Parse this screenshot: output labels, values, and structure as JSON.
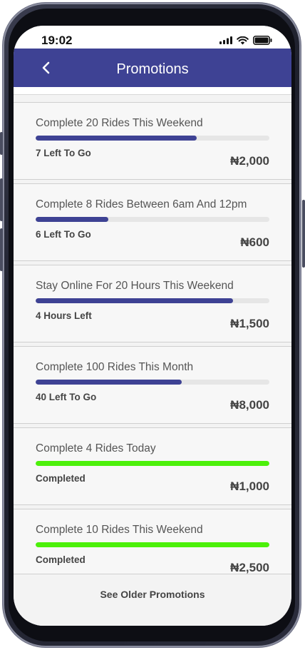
{
  "status_bar": {
    "time": "19:02",
    "icons": [
      "signal-icon",
      "wifi-icon",
      "battery-icon"
    ]
  },
  "header": {
    "back_icon": "chevron-left-icon",
    "title": "Promotions",
    "background": "#3e4294"
  },
  "colors": {
    "progress_active": "#3e4294",
    "progress_complete": "#4cf00a",
    "progress_track": "#e6e6e6"
  },
  "promotions": [
    {
      "title": "Complete 20 Rides This Weekend",
      "status": "7 Left To Go",
      "reward": "₦2,000",
      "progress": 0.69,
      "completed": false
    },
    {
      "title": "Complete 8 Rides Between 6am And 12pm",
      "status": "6 Left To Go",
      "reward": "₦600",
      "progress": 0.31,
      "completed": false
    },
    {
      "title": "Stay Online For 20 Hours This Weekend",
      "status": "4 Hours Left",
      "reward": "₦1,500",
      "progress": 0.845,
      "completed": false
    },
    {
      "title": "Complete 100 Rides This Month",
      "status": "40 Left To Go",
      "reward": "₦8,000",
      "progress": 0.625,
      "completed": false
    },
    {
      "title": "Complete 4 Rides Today",
      "status": "Completed",
      "reward": "₦1,000",
      "progress": 1.0,
      "completed": true
    },
    {
      "title": "Complete 10 Rides This Weekend",
      "status": "Completed",
      "reward": "₦2,500",
      "progress": 1.0,
      "completed": true
    }
  ],
  "footer": {
    "link_label": "See Older Promotions"
  }
}
